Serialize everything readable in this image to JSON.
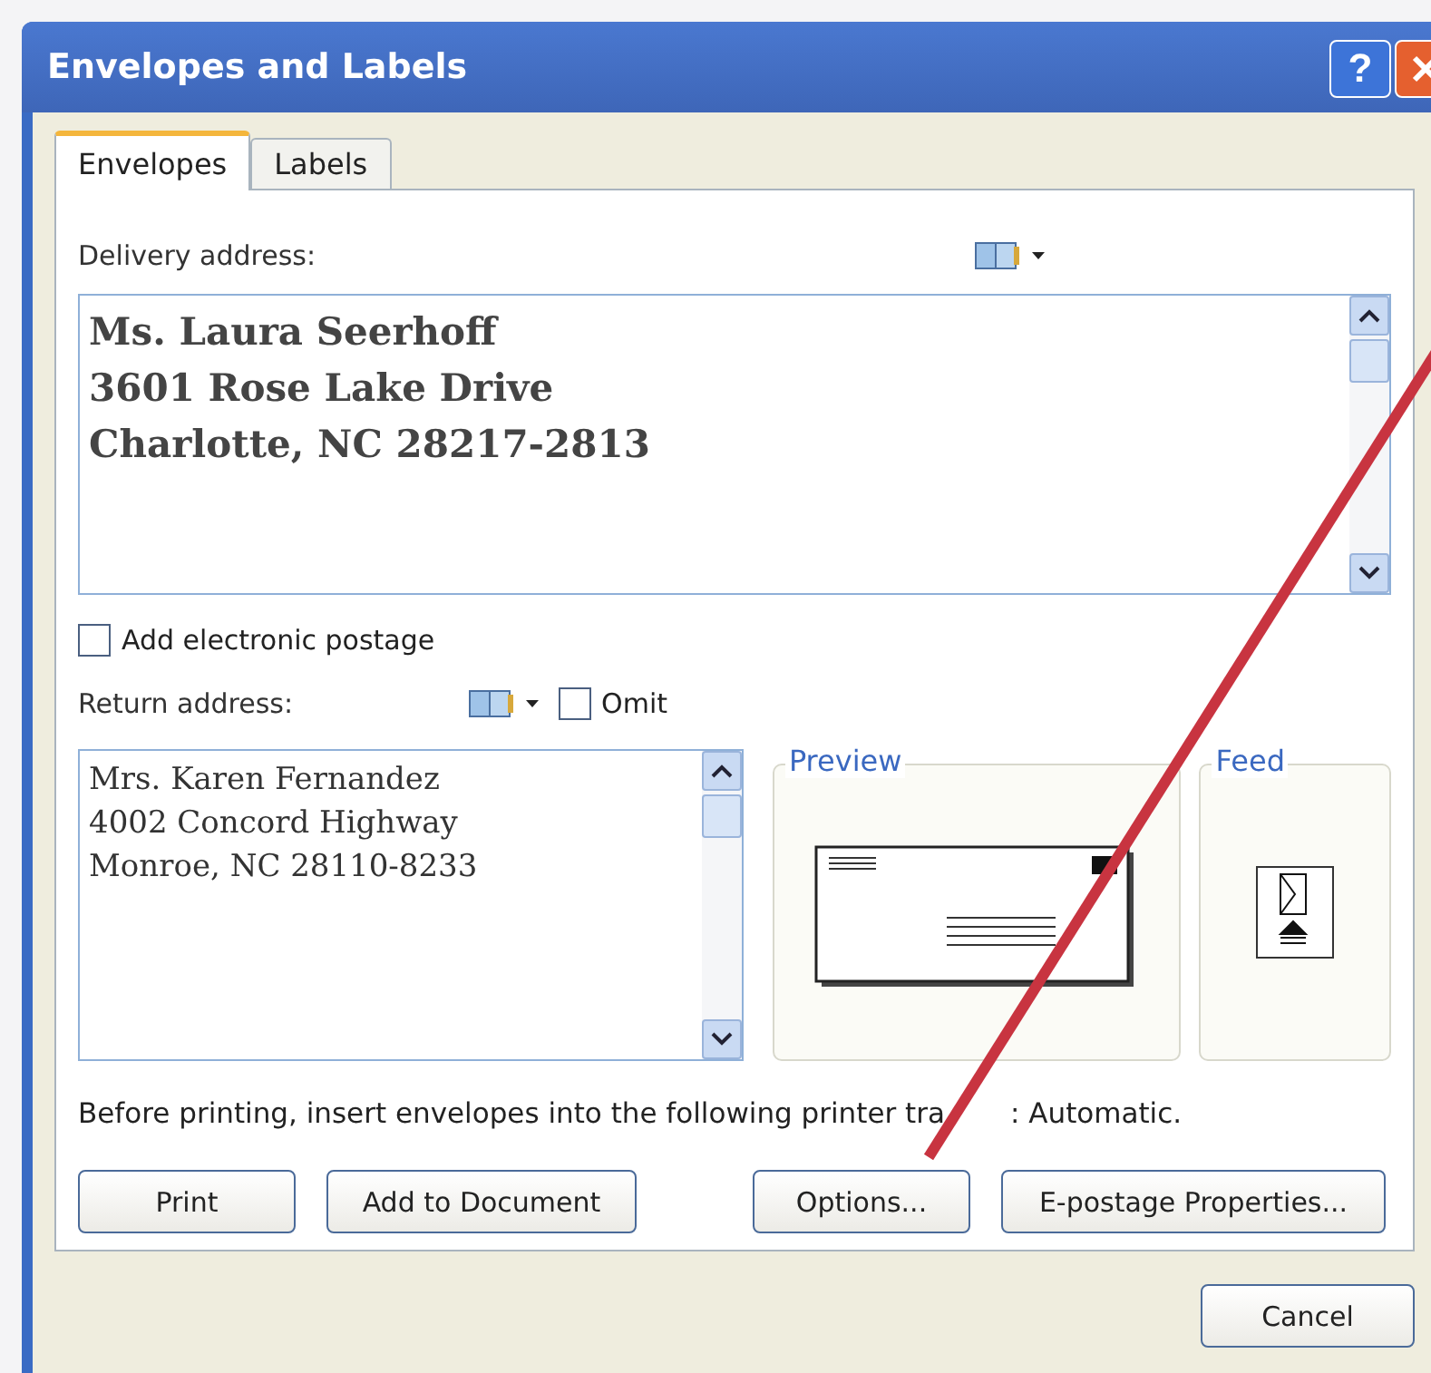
{
  "window": {
    "title": "Envelopes and Labels",
    "help_button": "?"
  },
  "tabs": [
    {
      "label": "Envelopes",
      "selected": true
    },
    {
      "label": "Labels",
      "selected": false
    }
  ],
  "delivery": {
    "label": "Delivery address:",
    "lines": [
      "Ms. Laura Seerhoff",
      "3601 Rose Lake Drive",
      "Charlotte, NC 28217-2813"
    ]
  },
  "electronic_postage": {
    "label": "Add electronic postage",
    "checked": false
  },
  "return": {
    "label": "Return address:",
    "omit": {
      "label": "Omit",
      "checked": false
    },
    "lines": [
      "Mrs. Karen Fernandez",
      "4002 Concord Highway",
      "Monroe, NC 28110-8233"
    ]
  },
  "preview": {
    "label": "Preview"
  },
  "feed": {
    "label": "Feed"
  },
  "tray_note": [
    "Before printing, insert envelopes into the following printer tra",
    ": Automatic."
  ],
  "buttons": [
    "Print",
    "Add to Document",
    "Options...",
    "E-postage Properties..."
  ],
  "cancel": "Cancel"
}
